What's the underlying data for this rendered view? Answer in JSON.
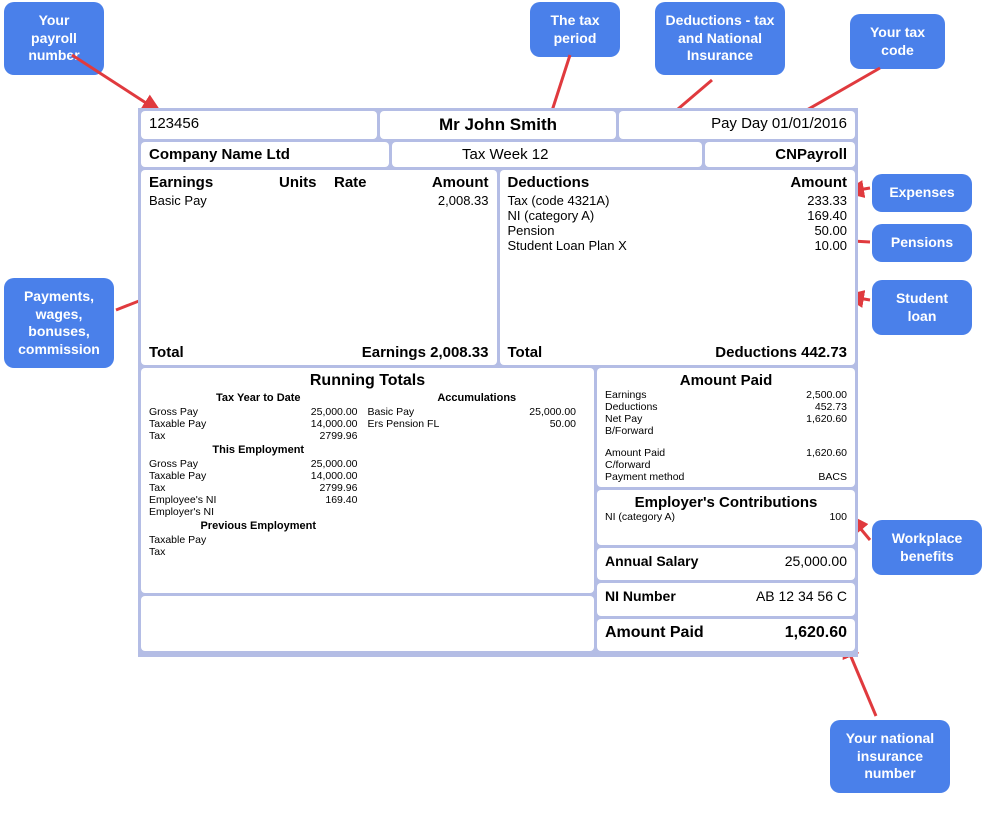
{
  "callouts": {
    "payroll_number": "Your payroll number",
    "tax_period": "The tax period",
    "deductions": "Deductions - tax and National Insurance",
    "tax_code": "Your tax code",
    "expenses": "Expenses",
    "pensions": "Pensions",
    "payments": "Payments, wages, bonuses, commission",
    "student_loan": "Student loan",
    "workplace_benefits": "Workplace benefits",
    "ni_number": "Your national insurance number"
  },
  "header": {
    "payroll_no": "123456",
    "name": "Mr John Smith",
    "pay_day": "Pay Day 01/01/2016",
    "company": "Company Name Ltd",
    "tax_week": "Tax Week 12",
    "system": "CNPayroll"
  },
  "earnings": {
    "head_label": "Earnings",
    "head_units": "Units",
    "head_rate": "Rate",
    "head_amount": "Amount",
    "basic_pay_label": "Basic Pay",
    "basic_pay_amount": "2,008.33",
    "total_label": "Total",
    "total_value": "Earnings 2,008.33"
  },
  "deductions_block": {
    "head_label": "Deductions",
    "head_amount": "Amount",
    "lines": [
      {
        "label": "Tax (code 4321A)",
        "amount": "233.33"
      },
      {
        "label": "NI (category A)",
        "amount": "169.40"
      },
      {
        "label": "Pension",
        "amount": "50.00"
      },
      {
        "label": "Student Loan Plan X",
        "amount": "10.00"
      }
    ],
    "total_label": "Total",
    "total_value": "Deductions 442.73"
  },
  "running_totals": {
    "title": "Running Totals",
    "left_sections": [
      {
        "name": "Tax Year to Date",
        "rows": [
          {
            "l": "Gross Pay",
            "r": "25,000.00"
          },
          {
            "l": "Taxable Pay",
            "r": "14,000.00"
          },
          {
            "l": "Tax",
            "r": "2799.96"
          }
        ]
      },
      {
        "name": "This Employment",
        "rows": [
          {
            "l": "Gross Pay",
            "r": "25,000.00"
          },
          {
            "l": "Taxable Pay",
            "r": "14,000.00"
          },
          {
            "l": "Tax",
            "r": "2799.96"
          },
          {
            "l": "Employee's NI",
            "r": "169.40"
          },
          {
            "l": "Employer's NI",
            "r": ""
          }
        ]
      },
      {
        "name": "Previous Employment",
        "rows": [
          {
            "l": "Taxable Pay",
            "r": ""
          },
          {
            "l": "Tax",
            "r": ""
          }
        ]
      }
    ],
    "right_section": {
      "name": "Accumulations",
      "rows": [
        {
          "l": "Basic Pay",
          "r": "25,000.00"
        },
        {
          "l": "Ers Pension FL",
          "r": "50.00"
        }
      ]
    }
  },
  "amount_paid": {
    "title": "Amount Paid",
    "rows": [
      {
        "l": "Earnings",
        "r": "2,500.00"
      },
      {
        "l": "Deductions",
        "r": "452.73"
      },
      {
        "l": "Net Pay",
        "r": "1,620.60"
      },
      {
        "l": "B/Forward",
        "r": ""
      },
      {
        "l": "",
        "r": ""
      },
      {
        "l": "Amount Paid",
        "r": "1,620.60"
      },
      {
        "l": "C/forward",
        "r": ""
      },
      {
        "l": "Payment method",
        "r": "BACS"
      }
    ]
  },
  "employer_contrib": {
    "title": "Employer's Contributions",
    "row_label": "NI (category A)",
    "row_value": "100"
  },
  "annual_salary": {
    "label": "Annual Salary",
    "value": "25,000.00"
  },
  "ni_number": {
    "label": "NI Number",
    "value": "AB 12 34 56 C"
  },
  "amount_paid_big": {
    "label": "Amount Paid",
    "value": "1,620.60"
  }
}
